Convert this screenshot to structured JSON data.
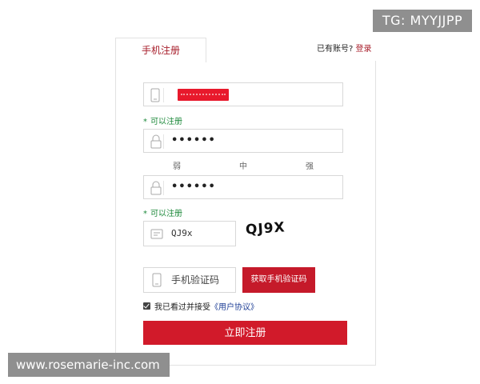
{
  "overlay": {
    "tg_badge": "TG: MYYJJPP",
    "site_watermark": "www.rosemarie-inc.com"
  },
  "tabs": [
    {
      "label": "手机注册"
    }
  ],
  "login_hint": {
    "prefix": "已有账号?",
    "link": "登录"
  },
  "form": {
    "phone": {
      "icon": "phone-icon"
    },
    "phone_hint": {
      "star": "*",
      "text": "可以注册"
    },
    "password": {
      "value": "••••••",
      "icon": "lock-icon"
    },
    "strength": [
      "弱",
      "中",
      "强"
    ],
    "confirm_password": {
      "value": "••••••",
      "icon": "lock-icon"
    },
    "confirm_hint": {
      "star": "*",
      "text": "可以注册"
    },
    "captcha": {
      "value": "QJ9x",
      "icon": "message-icon",
      "image_text": "QJ9X"
    },
    "sms": {
      "placeholder": "手机验证码",
      "icon": "phone-icon",
      "button": "获取手机验证码"
    },
    "agreement": {
      "prefix": "我已看过并接受",
      "link": "《用户协议》",
      "checked": true
    },
    "submit": "立即注册"
  },
  "colors": {
    "accent": "#c51a2a",
    "success": "#1e8a3c",
    "link": "#1f3f96"
  }
}
